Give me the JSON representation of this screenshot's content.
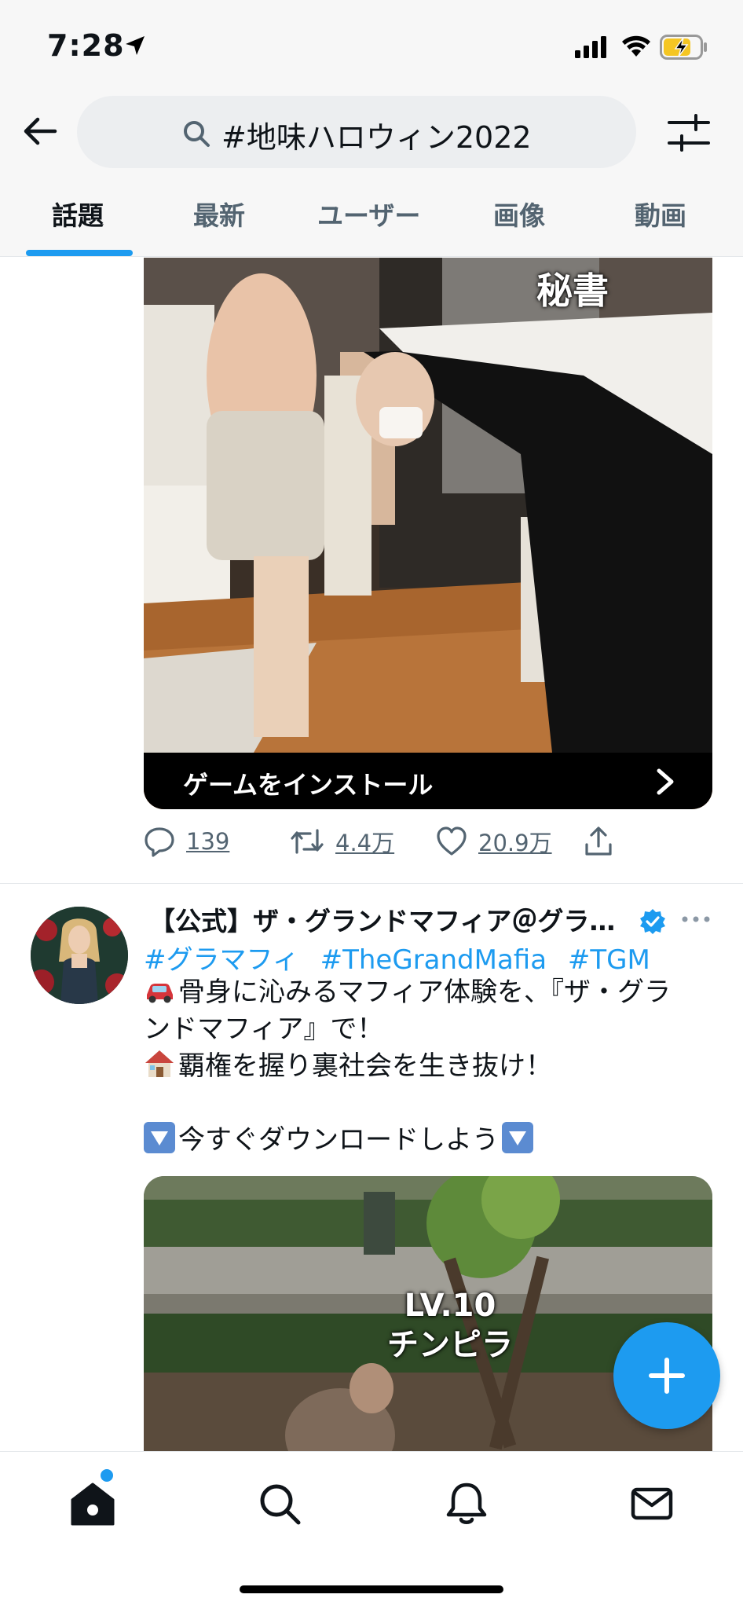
{
  "status_bar": {
    "time": "7:28"
  },
  "header": {
    "search_query": "#地味ハロウィン2022",
    "tabs": [
      {
        "label": "話題",
        "active": true
      },
      {
        "label": "最新",
        "active": false
      },
      {
        "label": "ユーザー",
        "active": false
      },
      {
        "label": "画像",
        "active": false
      },
      {
        "label": "動画",
        "active": false
      }
    ]
  },
  "tweet1": {
    "media_caption": "秘書",
    "install_label": "ゲームをインストール",
    "replies": "139",
    "retweets": "4.4万",
    "likes": "20.9万"
  },
  "tweet2": {
    "name": "【公式】ザ・グランドマフィア＠グラ…",
    "hashtags": [
      "#グラマフィ",
      "#TheGrandMafia",
      "#TGM"
    ],
    "line1": "骨身に沁みるマフィア体験を、『ザ・グラ",
    "line2": "ンドマフィア』で！",
    "line3": "覇権を握り裏社会を生き抜け！",
    "line4": "今すぐダウンロードしよう",
    "media_caption_1": "LV.10",
    "media_caption_2": "チンピラ"
  },
  "colors": {
    "accent": "#1d9bf0",
    "text": "#0f1419",
    "muted": "#536471"
  },
  "icons": [
    "back-arrow-icon",
    "search-icon",
    "filter-icon",
    "reply-icon",
    "retweet-icon",
    "like-icon",
    "share-icon",
    "verified-icon",
    "more-icon",
    "compose-icon",
    "home-icon",
    "explore-icon",
    "notifications-icon",
    "messages-icon"
  ]
}
